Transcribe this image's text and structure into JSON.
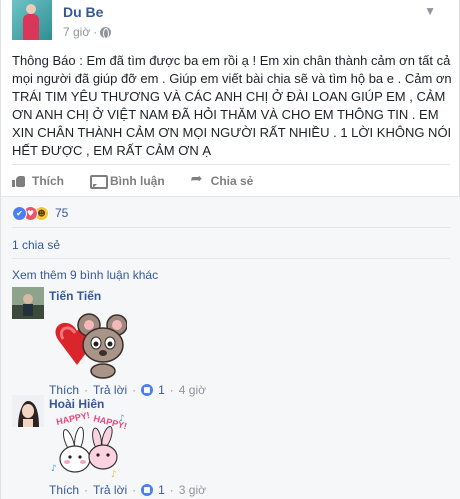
{
  "post": {
    "author": "Du Be",
    "time": "7 giờ",
    "text": "Thông Báo : Em đã tìm được ba em rồi ạ ! Em xin chân thành cảm ơn tất cả mọi người đã giúp đỡ em . Giúp em viết bài chia sẽ và tìm hộ ba e . Cảm ơn TRÁI TIM YÊU THƯƠNG VÀ CÁC ANH CHỊ Ở ĐÀI LOAN GIÚP EM , CẢM ƠN ANH CHỊ Ở VIỆT NAM ĐÃ HỎI THĂM VÀ CHO EM THÔNG TIN . EM XIN CHÂN THÀNH CẢM ƠN MỌI NGƯỜI RẤT NHIỀU . 1 LỜI KHÔNG NÓI HẾT ĐƯỢC , EM RẤT CẢM ƠN Ạ"
  },
  "actions": {
    "like": "Thích",
    "comment": "Bình luận",
    "share": "Chia sẻ"
  },
  "reactions": {
    "count": "75",
    "types": [
      "like-icon",
      "love-icon",
      "haha-icon"
    ]
  },
  "shares": "1 chia sẻ",
  "see_more": "Xem thêm 9 bình luận khác",
  "comments": [
    {
      "name": "Tiến Tiến",
      "sticker": "mouse-heart-sticker",
      "like": "Thích",
      "reply": "Trả lời",
      "likes": "1",
      "time": "4 giờ"
    },
    {
      "name": "Hoài Hiên",
      "sticker": "bunny-happy-sticker",
      "sticker_text": "HAPPY! HAPPY!",
      "like": "Thích",
      "reply": "Trả lời",
      "likes": "1",
      "time": "3 giờ"
    }
  ],
  "colors": {
    "link": "#365899",
    "meta": "#90949c",
    "like_blue": "#4a80f3",
    "love_red": "#f25268",
    "haha_yellow": "#f7c538"
  }
}
